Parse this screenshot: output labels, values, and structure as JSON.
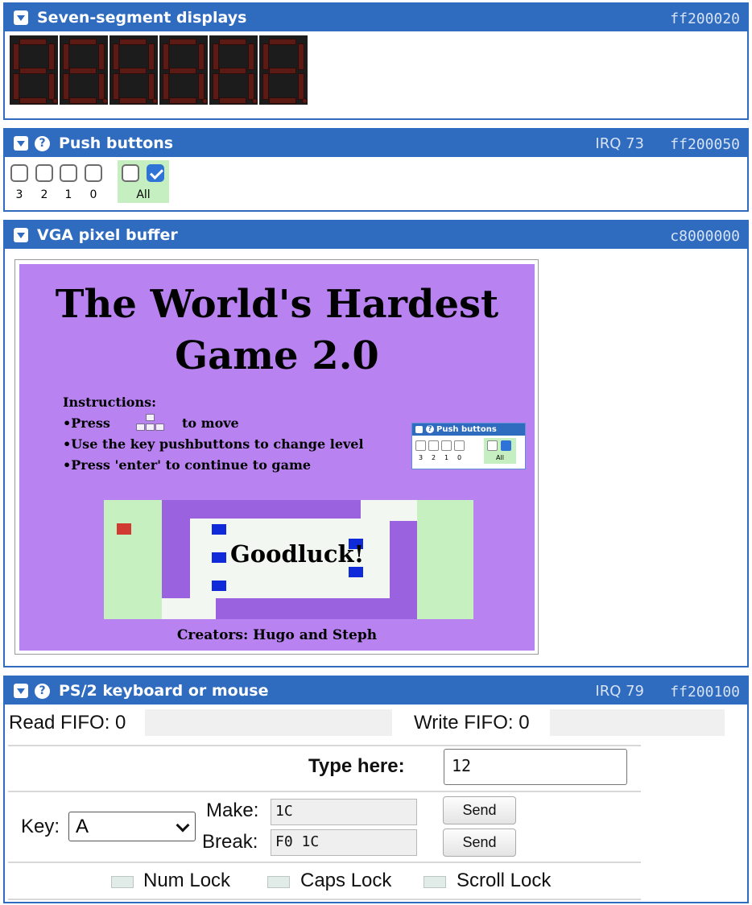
{
  "seven_segment": {
    "title": "Seven-segment displays",
    "address": "ff200020",
    "digit_count": 6
  },
  "push_buttons": {
    "title": "Push buttons",
    "irq": "IRQ 73",
    "address": "ff200050",
    "buttons": [
      {
        "label": "3",
        "checked": false
      },
      {
        "label": "2",
        "checked": false
      },
      {
        "label": "1",
        "checked": false
      },
      {
        "label": "0",
        "checked": false
      }
    ],
    "all_label": "All",
    "all_unchecked": false,
    "all_checked": true
  },
  "vga": {
    "title": "VGA pixel buffer",
    "address": "c8000000",
    "screen": {
      "title_line1": "The World's Hardest",
      "title_line2": "Game 2.0",
      "instructions_heading": "Instructions:",
      "instr_press": "•Press",
      "instr_to_move": "to move",
      "instr_line2": "•Use the key pushbuttons to change level",
      "instr_line3": "•Press 'enter' to continue to game",
      "mini_panel_title": "Push buttons",
      "mini_labels": [
        "3",
        "2",
        "1",
        "0"
      ],
      "mini_all": "All",
      "goodluck": "Goodluck!",
      "creators": "Creators: Hugo and Steph",
      "colors": {
        "background": "#b882f0",
        "maze_wall": "#9a62df",
        "maze_floor": "#f2f7f2",
        "safe_zone": "#c6f0c0",
        "player": "#d03a30",
        "enemy": "#0f2ad8"
      }
    }
  },
  "ps2": {
    "title": "PS/2 keyboard or mouse",
    "irq": "IRQ 79",
    "address": "ff200100",
    "read_fifo": "Read FIFO: 0",
    "write_fifo": "Write FIFO: 0",
    "type_here_label": "Type here:",
    "type_here_value": "12",
    "key_label": "Key:",
    "key_selected": "A",
    "make_label": "Make:",
    "make_value": "1C",
    "break_label": "Break:",
    "break_value": "F0 1C",
    "send_label": "Send",
    "locks": [
      "Num Lock",
      "Caps Lock",
      "Scroll Lock"
    ]
  },
  "theme": {
    "header_blue": "#2f6bbf",
    "checkbox_blue": "#2f73d6",
    "all_bg": "#c6efc1"
  }
}
